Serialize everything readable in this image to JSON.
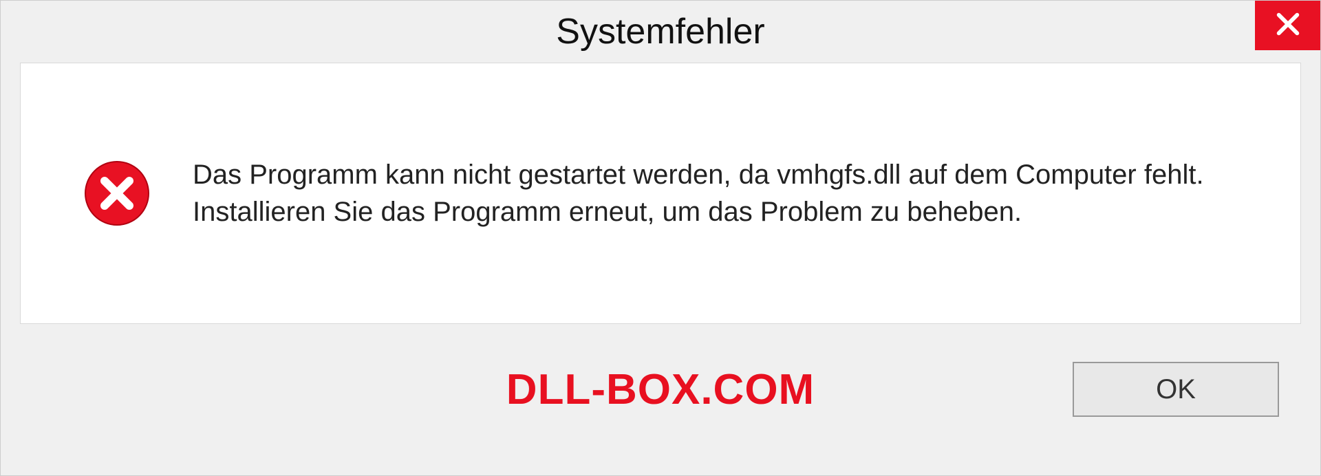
{
  "dialog": {
    "title": "Systemfehler",
    "message": "Das Programm kann nicht gestartet werden, da vmhgfs.dll auf dem Computer fehlt. Installieren Sie das Programm erneut, um das Problem zu beheben.",
    "ok_label": "OK"
  },
  "watermark": "DLL-BOX.COM"
}
